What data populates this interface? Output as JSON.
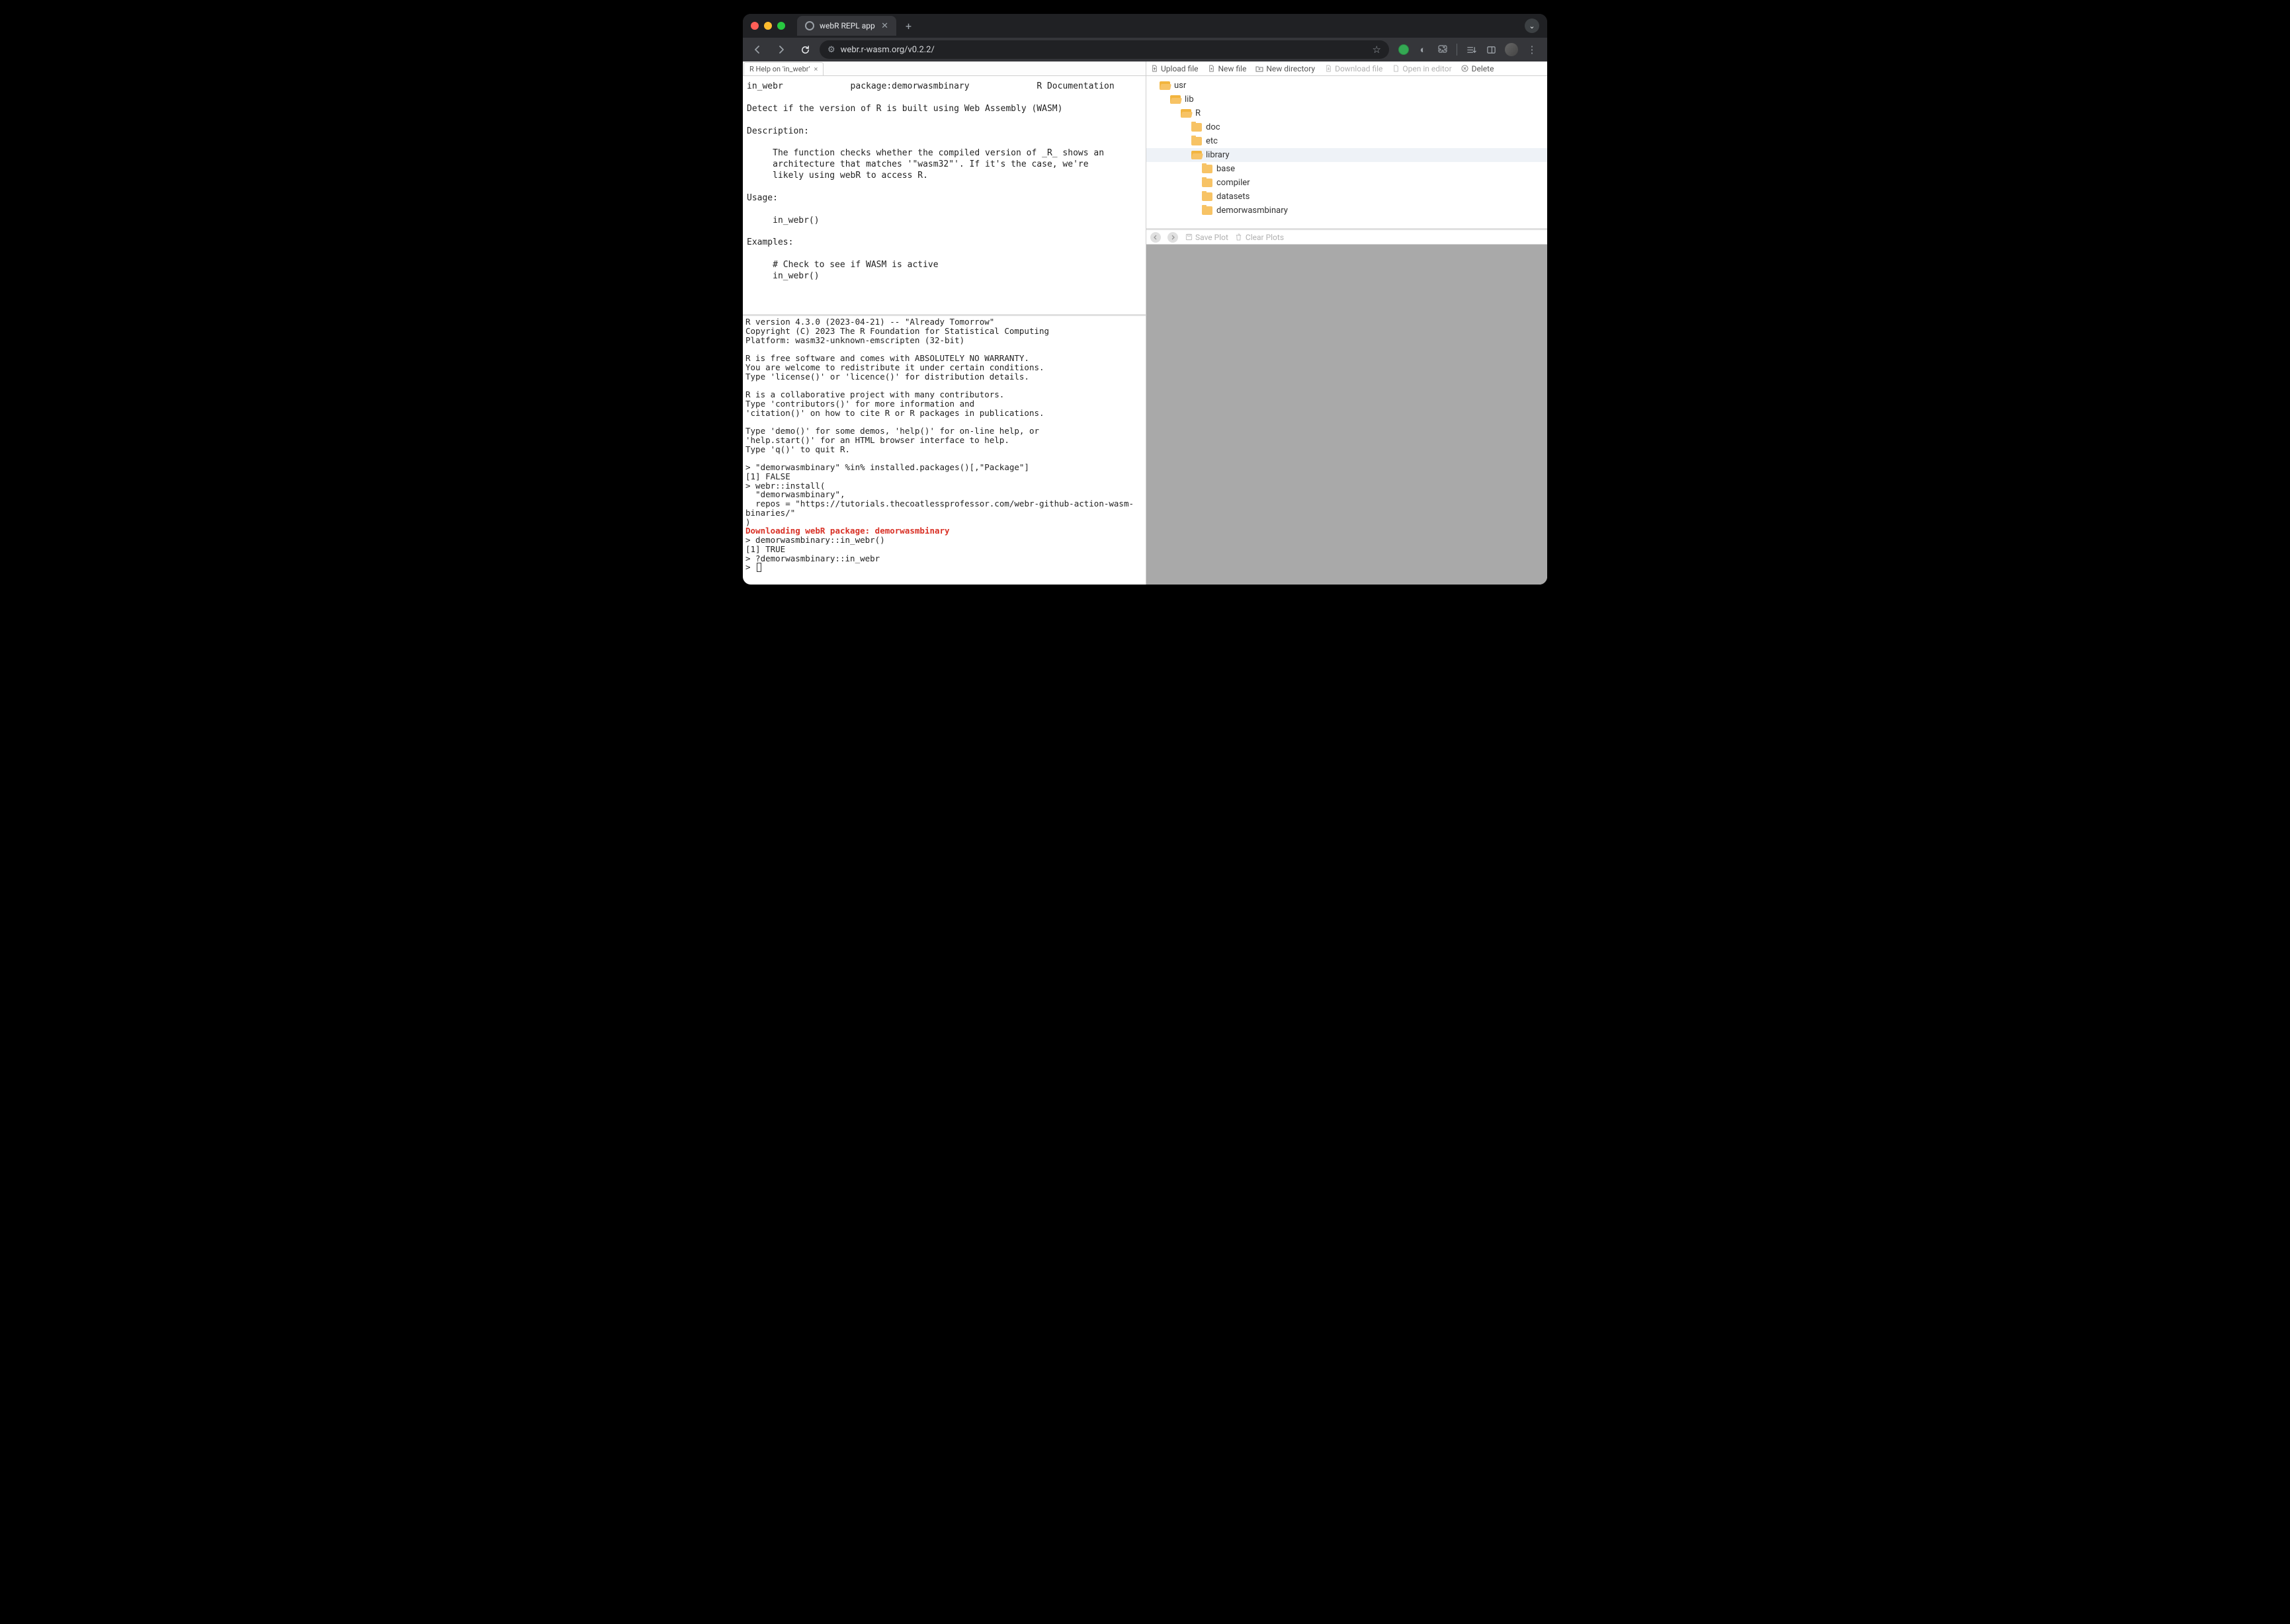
{
  "browser": {
    "tab_title": "webR REPL app",
    "url": "webr.r-wasm.org/v0.2.2/"
  },
  "help": {
    "tab_label": "R Help on 'in_webr'",
    "header_left": "in_webr",
    "header_mid": "package:demorwasmbinary",
    "header_right": "R Documentation",
    "title": "Detect if the version of R is built using Web Assembly (WASM)",
    "desc_heading": "Description:",
    "desc_body": "     The function checks whether the compiled version of _R_ shows an\n     architecture that matches '\"wasm32\"'. If it's the case, we're\n     likely using webR to access R.",
    "usage_heading": "Usage:",
    "usage_body": "     in_webr()",
    "examples_heading": "Examples:",
    "examples_body": "     # Check to see if WASM is active\n     in_webr()"
  },
  "console": {
    "banner": "R version 4.3.0 (2023-04-21) -- \"Already Tomorrow\"\nCopyright (C) 2023 The R Foundation for Statistical Computing\nPlatform: wasm32-unknown-emscripten (32-bit)\n\nR is free software and comes with ABSOLUTELY NO WARRANTY.\nYou are welcome to redistribute it under certain conditions.\nType 'license()' or 'licence()' for distribution details.\n\nR is a collaborative project with many contributors.\nType 'contributors()' for more information and\n'citation()' on how to cite R or R packages in publications.\n\nType 'demo()' for some demos, 'help()' for on-line help, or\n'help.start()' for an HTML browser interface to help.\nType 'q()' to quit R.\n",
    "line1": "> \"demorwasmbinary\" %in% installed.packages()[,\"Package\"]",
    "line2": "[1] FALSE",
    "line3": "> webr::install(",
    "line4": "  \"demorwasmbinary\",",
    "line5": "  repos = \"https://tutorials.thecoatlessprofessor.com/webr-github-action-wasm-binaries/\"",
    "line6": ")",
    "line_dl": "Downloading webR package: demorwasmbinary",
    "line7": "> demorwasmbinary::in_webr()",
    "line8": "[1] TRUE",
    "line9": "> ?demorwasmbinary::in_webr",
    "prompt": "> "
  },
  "files": {
    "toolbar": {
      "upload": "Upload file",
      "newfile": "New file",
      "newdir": "New directory",
      "download": "Download file",
      "open": "Open in editor",
      "delete": "Delete"
    },
    "tree": [
      {
        "name": "usr",
        "depth": 0,
        "open": true
      },
      {
        "name": "lib",
        "depth": 1,
        "open": true
      },
      {
        "name": "R",
        "depth": 2,
        "open": true
      },
      {
        "name": "doc",
        "depth": 3,
        "open": false
      },
      {
        "name": "etc",
        "depth": 3,
        "open": false
      },
      {
        "name": "library",
        "depth": 3,
        "open": true,
        "selected": true
      },
      {
        "name": "base",
        "depth": 4,
        "open": false
      },
      {
        "name": "compiler",
        "depth": 4,
        "open": false
      },
      {
        "name": "datasets",
        "depth": 4,
        "open": false
      },
      {
        "name": "demorwasmbinary",
        "depth": 4,
        "open": false
      }
    ]
  },
  "plots": {
    "save": "Save Plot",
    "clear": "Clear Plots"
  }
}
